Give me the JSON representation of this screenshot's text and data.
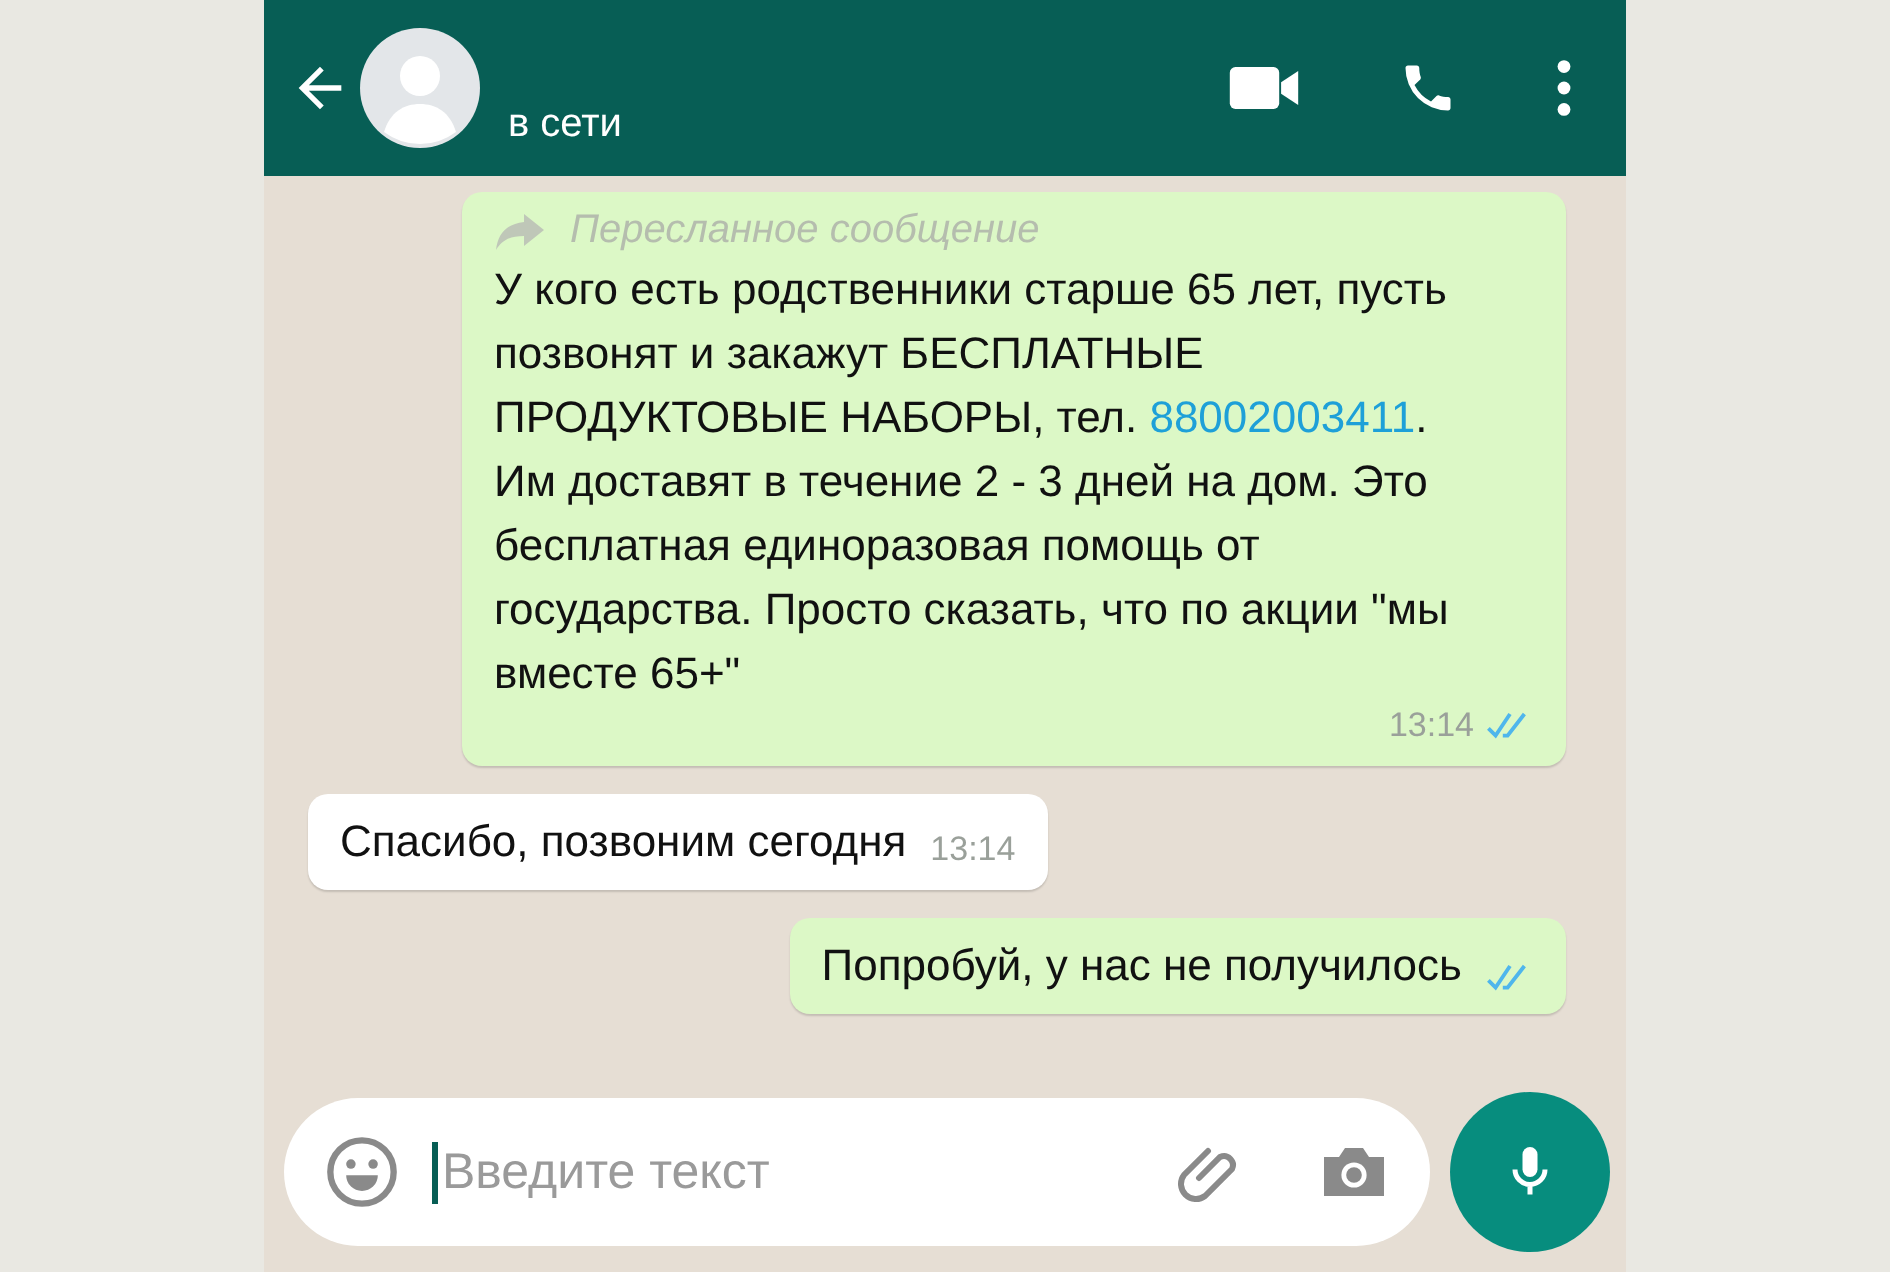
{
  "header": {
    "status": "в сети"
  },
  "messages": [
    {
      "kind": "outgoing",
      "forwarded": true,
      "forwarded_label": "Пересланное сообщение",
      "parts": [
        {
          "kind": "text",
          "text": "У кого есть родственники старше 65 лет, пусть позвонят и закажут БЕСПЛАТНЫЕ ПРОДУКТОВЫЕ НАБОРЫ, тел. "
        },
        {
          "kind": "phone",
          "text": "88002003411"
        },
        {
          "kind": "text",
          "text": ". Им доставят в течение 2 - 3 дней на дом. Это бесплатная единоразовая помощь от государства. Просто сказать, что по акции \"мы вместе 65+\""
        }
      ],
      "time": "13:14",
      "read": true
    },
    {
      "kind": "incoming",
      "forwarded": false,
      "parts": [
        {
          "kind": "text",
          "text": "Спасибо, позвоним сегодня"
        }
      ],
      "time": "13:14"
    },
    {
      "kind": "outgoing",
      "forwarded": false,
      "parts": [
        {
          "kind": "text",
          "text": "Попробуй, у нас не получилось"
        }
      ],
      "read": true
    }
  ],
  "composer": {
    "placeholder": "Введите текст"
  }
}
